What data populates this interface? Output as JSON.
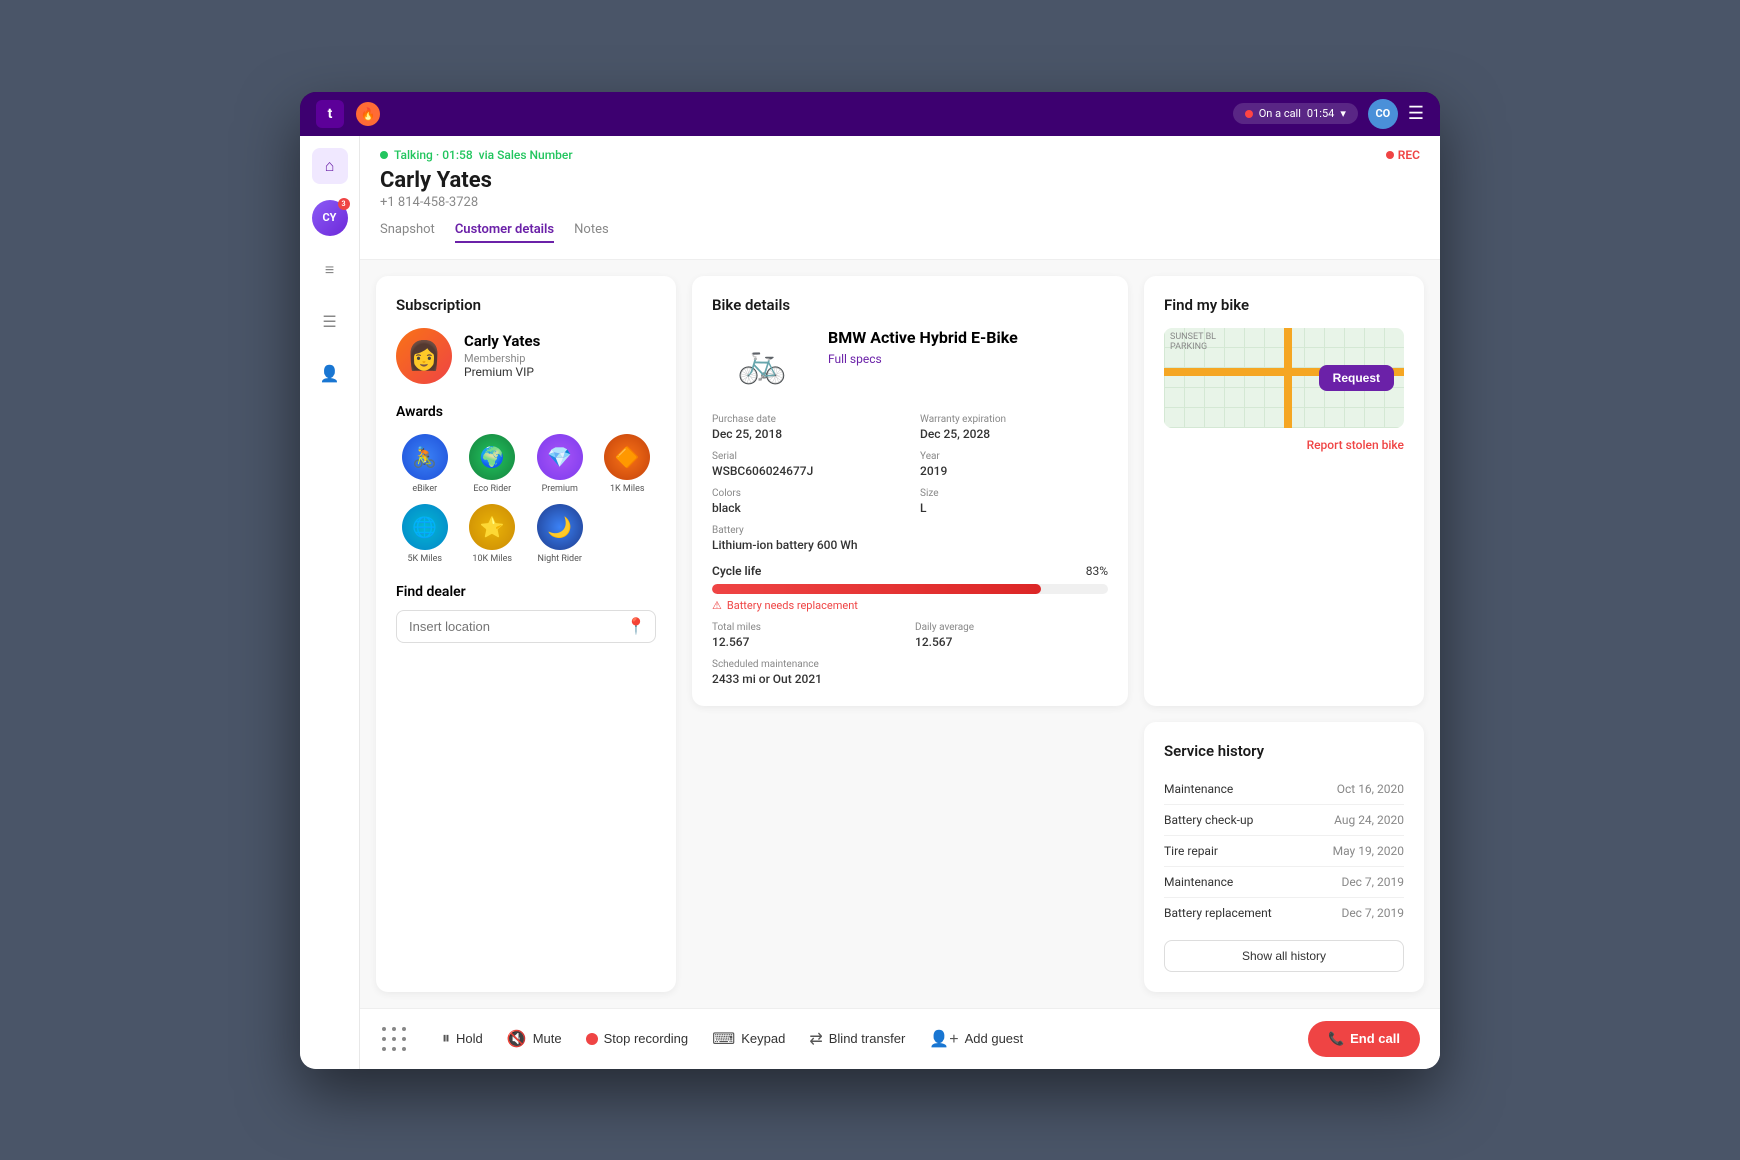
{
  "browser": {
    "logo": "t",
    "call_status": "On a call",
    "call_timer": "01:54",
    "avatar_initials": "CO"
  },
  "sidebar": {
    "icons": [
      "⊞",
      "≡",
      "≡",
      "☰",
      "👤"
    ]
  },
  "call_header": {
    "status": "Talking · 01:58",
    "via": "via Sales Number",
    "customer_name": "Carly Yates",
    "phone": "+1 814-458-3728",
    "rec_label": "REC",
    "tabs": [
      "Snapshot",
      "Customer details",
      "Notes"
    ],
    "active_tab": "Customer details"
  },
  "subscription": {
    "title": "Subscription",
    "customer_name": "Carly Yates",
    "membership_label": "Membership",
    "membership_value": "Premium VIP"
  },
  "awards": {
    "title": "Awards",
    "items": [
      {
        "label": "eBiker",
        "emoji": "🚴"
      },
      {
        "label": "Eco Rider",
        "emoji": "🌍"
      },
      {
        "label": "Premium",
        "emoji": "💎"
      },
      {
        "label": "1K Miles",
        "emoji": "🔶"
      },
      {
        "label": "5K Miles",
        "emoji": "🌐"
      },
      {
        "label": "10K Miles",
        "emoji": "⭐"
      },
      {
        "label": "Night Rider",
        "emoji": "🌙"
      }
    ]
  },
  "find_dealer": {
    "title": "Find dealer",
    "placeholder": "Insert location"
  },
  "bike_details": {
    "title": "Bike details",
    "name": "BMW Active Hybrid E-Bike",
    "full_specs": "Full specs",
    "purchase_date_label": "Purchase date",
    "purchase_date": "Dec 25, 2018",
    "warranty_label": "Warranty expiration",
    "warranty": "Dec 25, 2028",
    "serial_label": "Serial",
    "serial": "WSBC606024677J",
    "year_label": "Year",
    "year": "2019",
    "colors_label": "Colors",
    "colors": "black",
    "size_label": "Size",
    "size": "L",
    "battery_label": "Battery",
    "battery": "Lithium-ion battery 600 Wh",
    "cycle_life_label": "Cycle life",
    "cycle_pct": "83%",
    "cycle_pct_num": 83,
    "battery_warning": "Battery needs replacement",
    "total_miles_label": "Total miles",
    "total_miles": "12.567",
    "daily_avg_label": "Daily average",
    "daily_avg": "12.567",
    "scheduled_label": "Scheduled maintenance",
    "scheduled": "2433 mi or Out 2021"
  },
  "find_bike": {
    "title": "Find my bike",
    "request_btn": "Request",
    "report_stolen": "Report stolen bike"
  },
  "service_history": {
    "title": "Service history",
    "items": [
      {
        "name": "Maintenance",
        "date": "Oct 16, 2020"
      },
      {
        "name": "Battery check-up",
        "date": "Aug 24, 2020"
      },
      {
        "name": "Tire repair",
        "date": "May 19, 2020"
      },
      {
        "name": "Maintenance",
        "date": "Dec 7, 2019"
      },
      {
        "name": "Battery replacement",
        "date": "Dec 7, 2019"
      }
    ],
    "show_all": "Show all history"
  },
  "call_controls": {
    "hold": "Hold",
    "mute": "Mute",
    "stop_recording": "Stop recording",
    "keypad": "Keypad",
    "blind_transfer": "Blind transfer",
    "add_guest": "Add guest",
    "end_call": "End call"
  }
}
